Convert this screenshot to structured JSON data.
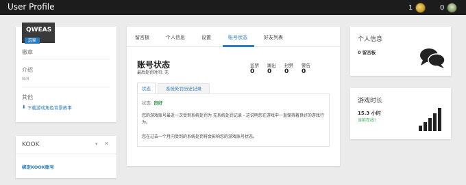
{
  "header": {
    "title": "User Profile",
    "gold_count": "1",
    "avatar_count": "0"
  },
  "profile": {
    "username": "QWEAS",
    "role_badge": "玩家",
    "badge_label": "徽章",
    "intro_label": "介绍",
    "intro_value": "N/A",
    "other_label": "其他",
    "download_link": "下载游戏角色背景故事"
  },
  "kook": {
    "title": "KOOK",
    "bind_link": "绑定KOOK账号"
  },
  "tabs": [
    {
      "label": "留言板",
      "active": false
    },
    {
      "label": "个人信息",
      "active": false
    },
    {
      "label": "设置",
      "active": false
    },
    {
      "label": "账号状态",
      "active": true
    },
    {
      "label": "好友列表",
      "active": false
    }
  ],
  "account": {
    "title": "账号状态",
    "last_punish": "最后处罚时间: 无",
    "stats": [
      {
        "label": "监禁",
        "value": "0"
      },
      {
        "label": "踢出",
        "value": "0"
      },
      {
        "label": "封禁",
        "value": "0"
      },
      {
        "label": "警告",
        "value": "0"
      }
    ],
    "subtabs": [
      "状态",
      "系统处罚历史记录"
    ],
    "status_prefix": "状态:",
    "status_value": "良好",
    "para1": "您的游戏账号最近一次受到系统处罚为 无系统处罚记录 - 这说明您在游戏中一直保持着良好的游戏行为。",
    "para2": "您在过去一个月内受到的系统处罚将会影响您的游戏账号状态。"
  },
  "personal_info": {
    "title": "个人信息",
    "messages": "0 留言板"
  },
  "playtime": {
    "title": "游戏时长",
    "hours": "15.3 小时",
    "online": "当前在线!"
  },
  "colors": {
    "accent": "#2a7bc0",
    "good": "#2e9b45",
    "online": "#3aa84a",
    "topbar": "#1c1c1c"
  }
}
